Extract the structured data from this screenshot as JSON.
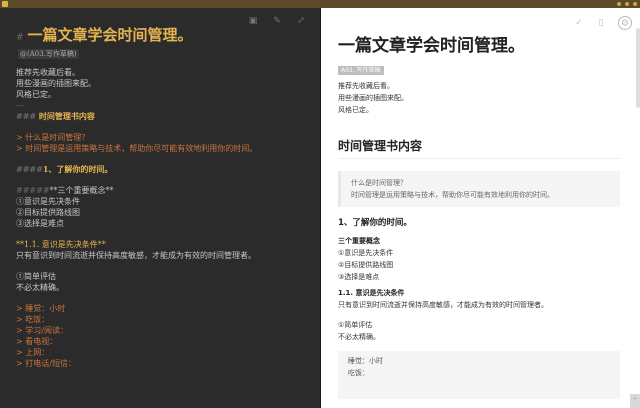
{
  "editor": {
    "h1_marker": "#",
    "h1": "一篇文章学会时间管理。",
    "tag": "@(A03.写作草稿)",
    "intro": [
      "推荐先收藏后看。",
      "用些漫画的插图来配。",
      "风格已定。"
    ],
    "hr": "---",
    "h2_marker": "###",
    "h2": "时间管理书内容",
    "quote": [
      "> 什么是时间管理？",
      "> 时间管理是运用策略与技术，帮助你尽可能有效地利用你的时间。"
    ],
    "h3_marker": "####",
    "h3": "1、了解你的时间。",
    "h5_marker": "#####",
    "h5": "**三个重要概念**",
    "list": [
      "①意识是先决条件",
      "②目标提供路线图",
      "③选择是难点"
    ],
    "bold_line": "**1.1. 意识是先决条件**",
    "text": "只有意识到时间流逝并保持高度敏感，才能成为有效的时间管理者。",
    "small_list": [
      "①简单评估",
      "不必太精确。"
    ],
    "quote_list": [
      "> 睡觉：小时",
      "> 吃饭：",
      "> 学习/阅读：",
      "> 看电视：",
      "> 上网：",
      "> 打电话/短信："
    ]
  },
  "preview": {
    "h1": "一篇文章学会时间管理。",
    "tag": "A03..写作草稿",
    "intro": [
      "推荐先收藏后看。",
      "用些漫画的插图来配。",
      "风格已定。"
    ],
    "h2": "时间管理书内容",
    "quote": [
      "什么是时间管理？",
      "时间管理是运用策略与技术，帮助你尽可能有效地利用你的时间。"
    ],
    "h3": "1、了解你的时间。",
    "h5": "三个重要概念",
    "list": [
      "①意识是先决条件",
      "②目标提供路线图",
      "③选择是难点"
    ],
    "bold_line": "1.1. 意识是先决条件",
    "text": "只有意识到时间流逝并保持高度敏感，才能成为有效的时间管理者。",
    "small_list": [
      "①简单评估",
      "不必太精确。"
    ],
    "code_list": [
      "睡觉：小时",
      "吃饭："
    ]
  },
  "icons": {
    "editor": [
      "image-icon",
      "pen-icon",
      "fullscreen-icon"
    ],
    "preview": [
      "check-icon",
      "document-icon",
      "user-icon"
    ]
  },
  "colors": {
    "accent": "#e6b450",
    "quote": "#c9753f",
    "editor_bg": "#2b2b2b"
  }
}
